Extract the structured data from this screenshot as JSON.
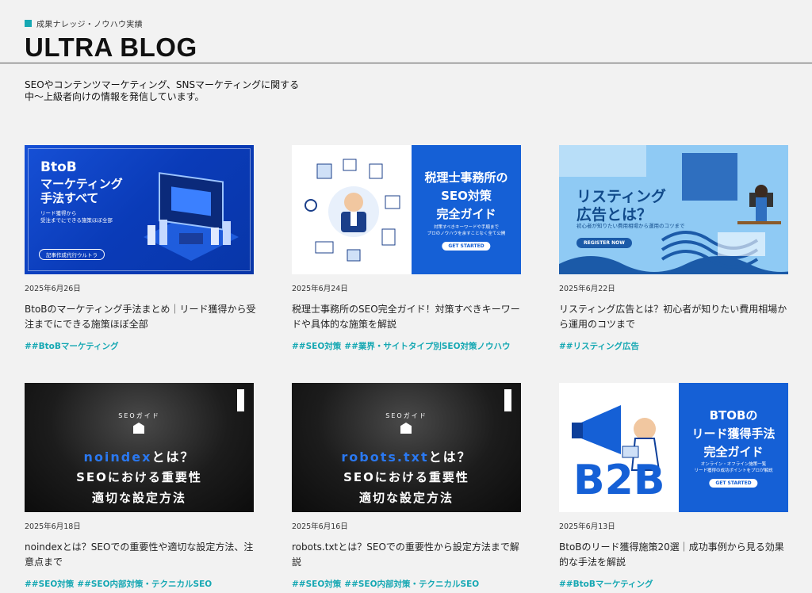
{
  "header": {
    "eyebrow": "成果ナレッジ・ノウハウ実績",
    "title": "ULTRA BLOG",
    "intro_line1": "SEOやコンテンツマーケティング、SNSマーケティングに関する",
    "intro_line2": "中〜上級者向けの情報を発信しています。"
  },
  "colors": {
    "accent": "#16a8b3",
    "background": "#f2f2f2"
  },
  "cards": [
    {
      "date": "2025年6月26日",
      "title": "BtoBのマーケティング手法まとめ｜リード獲得から受注までにできる施策ほぼ全部",
      "tags": [
        "##BtoBマーケティング"
      ],
      "thumb": {
        "l1": "BtoB",
        "l2": "マーケティング",
        "l3": "手法すべて",
        "s1": "リード獲得から",
        "s2": "受注までにできる施策ほぼ全部",
        "pill": "記事作成代行ウルトラ"
      }
    },
    {
      "date": "2025年6月24日",
      "title": "税理士事務所のSEO完全ガイド！対策すべきキーワードや具体的な施策を解説",
      "tags": [
        "##SEO対策",
        "##業界・サイトタイプ別SEO対策ノウハウ"
      ],
      "thumb": {
        "l1": "税理士事務所の",
        "l2": "SEO対策",
        "l3": "完全ガイド",
        "s1": "対策すべきキーワードや手順まで",
        "s2": "プロのノウハウを余すことなく全て公開",
        "btn": "GET STARTED"
      }
    },
    {
      "date": "2025年6月22日",
      "title": "リスティング広告とは？初心者が知りたい費用相場から運用のコツまで",
      "tags": [
        "##リスティング広告"
      ],
      "thumb": {
        "l1": "リスティング",
        "l2": "広告とは？",
        "s1": "初心者が知りたい費用相場から運用のコツまで",
        "btn": "REGISTER NOW"
      }
    },
    {
      "date": "2025年6月18日",
      "title": "noindexとは？SEOでの重要性や適切な設定方法、注意点まで",
      "tags": [
        "##SEO対策",
        "##SEO内部対策・テクニカルSEO"
      ],
      "thumb": {
        "small": "SEOガイド",
        "kw": "noindex",
        "after": "とは？",
        "l2": "SEOにおける重要性",
        "l3": "適切な設定方法"
      }
    },
    {
      "date": "2025年6月16日",
      "title": "robots.txtとは？SEOでの重要性から設定方法まで解説",
      "tags": [
        "##SEO対策",
        "##SEO内部対策・テクニカルSEO"
      ],
      "thumb": {
        "small": "SEOガイド",
        "kw": "robots.txt",
        "after": "とは？",
        "l2": "SEOにおける重要性",
        "l3": "適切な設定方法"
      }
    },
    {
      "date": "2025年6月13日",
      "title": "BtoBのリード獲得施策20選｜成功事例から見る効果的な手法を解説",
      "tags": [
        "##BtoBマーケティング"
      ],
      "thumb": {
        "l1": "BTOBの",
        "l2": "リード獲得手法",
        "l3": "完全ガイド",
        "s1": "オンライン・オフライン施策一覧",
        "s2": "リード獲得の成功ポイントをプロが解説",
        "btn": "GET STARTED",
        "big": "B2B"
      }
    }
  ]
}
